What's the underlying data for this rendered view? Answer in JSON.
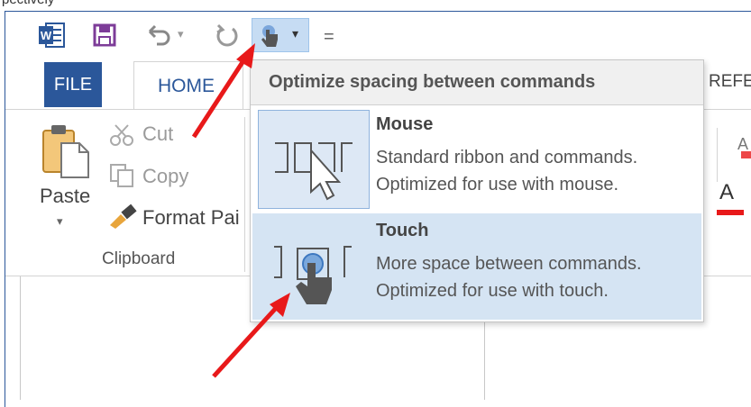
{
  "top_fragment": "pectively",
  "quick_access": {
    "undo_arrow": "▾",
    "touch_arrow": "▾",
    "customize_symbol": "="
  },
  "tabs": {
    "file": "FILE",
    "home": "HOME",
    "references": "REFE"
  },
  "clipboard": {
    "paste": "Paste",
    "cut": "Cut",
    "copy": "Copy",
    "format_painter": "Format Pai",
    "group_label": "Clipboard"
  },
  "popup": {
    "header": "Optimize spacing between commands",
    "options": [
      {
        "title": "Mouse",
        "line1": "Standard ribbon and commands.",
        "line2": "Optimized for use with mouse."
      },
      {
        "title": "Touch",
        "line1": "More space between commands.",
        "line2": "Optimized for use with touch."
      }
    ]
  },
  "font_group": {
    "font_color_letter": "A"
  },
  "colors": {
    "word_blue": "#2b579a",
    "highlight": "#d5e4f3",
    "annotation_red": "#e8191a",
    "save_purple": "#7d3c98"
  }
}
